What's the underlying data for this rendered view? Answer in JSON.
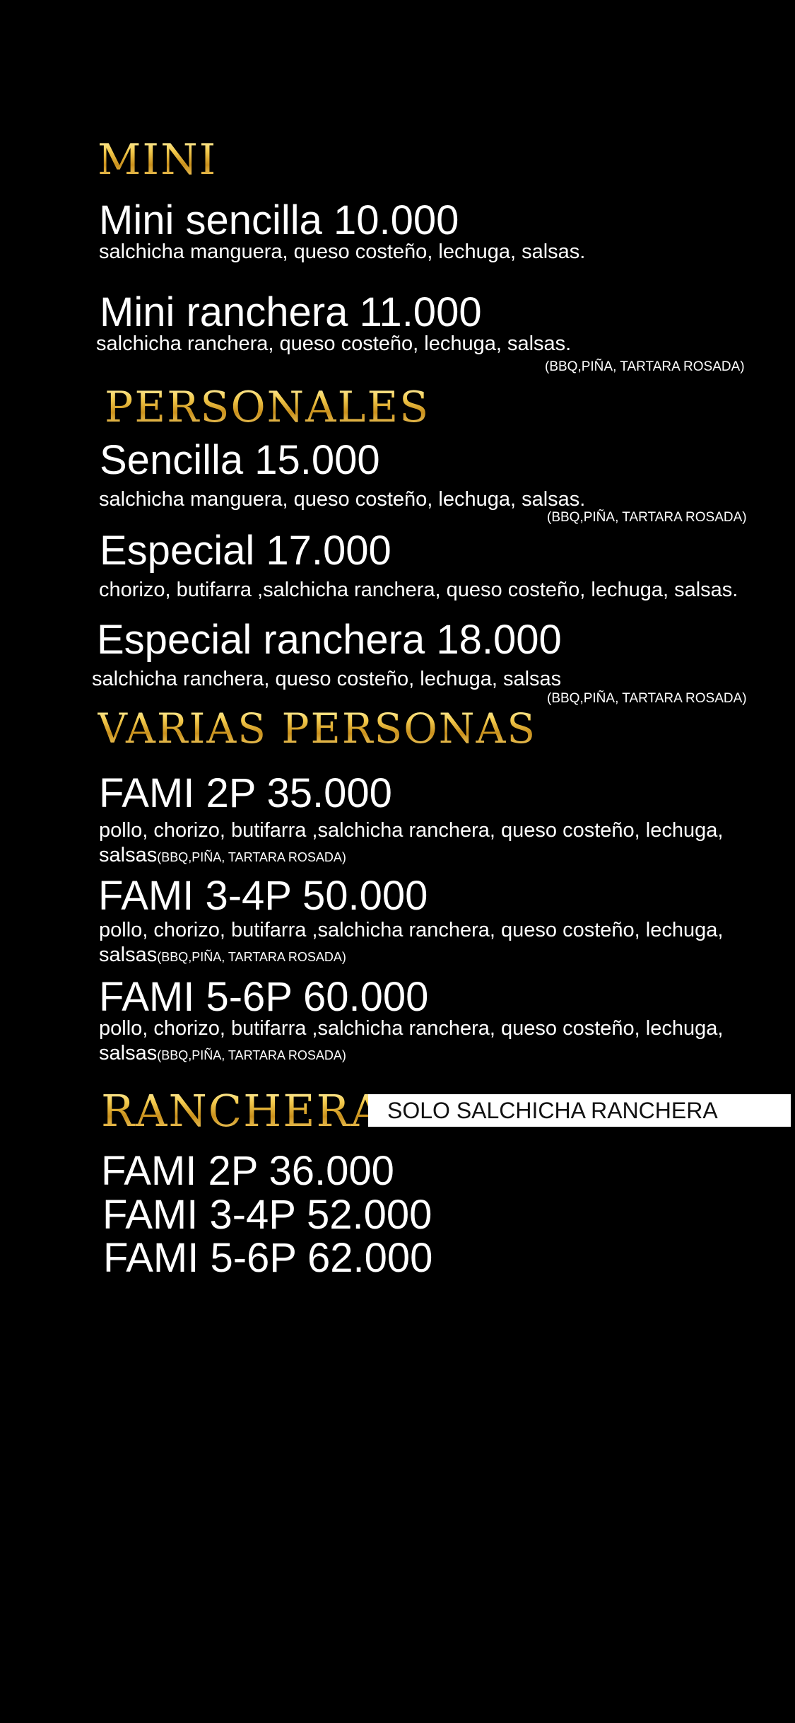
{
  "sections": {
    "mini": {
      "heading": "MINI",
      "items": [
        {
          "name": "Mini sencilla 10.000",
          "desc": "salchicha manguera, queso costeño, lechuga, salsas."
        },
        {
          "name": "Mini ranchera 11.000",
          "desc": "salchicha ranchera, queso costeño, lechuga, salsas.",
          "sauces": "(BBQ,PIÑA, TARTARA ROSADA)"
        }
      ]
    },
    "personales": {
      "heading": "PERSONALES",
      "items": [
        {
          "name": "Sencilla 15.000",
          "desc": "salchicha manguera, queso costeño, lechuga, salsas.",
          "sauces": "(BBQ,PIÑA, TARTARA ROSADA)"
        },
        {
          "name": "Especial 17.000",
          "desc": "chorizo, butifarra ,salchicha ranchera, queso costeño, lechuga, salsas."
        },
        {
          "name": "Especial ranchera 18.000",
          "desc": "salchicha ranchera, queso costeño, lechuga, salsas",
          "sauces": "(BBQ,PIÑA, TARTARA ROSADA)"
        }
      ]
    },
    "varias": {
      "heading": "VARIAS PERSONAS",
      "items": [
        {
          "name": "FAMI 2P  35.000",
          "desc": "pollo, chorizo, butifarra ,salchicha ranchera, queso costeño, lechuga, salsas",
          "sauces": "(BBQ,PIÑA, TARTARA ROSADA)"
        },
        {
          "name": "FAMI 3-4P 50.000",
          "desc": "pollo, chorizo, butifarra ,salchicha ranchera, queso costeño, lechuga, salsas",
          "sauces": "(BBQ,PIÑA, TARTARA ROSADA)"
        },
        {
          "name": "FAMI 5-6P 60.000",
          "desc": "pollo, chorizo, butifarra ,salchicha ranchera, queso costeño, lechuga, salsas",
          "sauces": "(BBQ,PIÑA, TARTARA ROSADA)"
        }
      ]
    },
    "ranchera": {
      "heading": "RANCHERA",
      "note": "SOLO SALCHICHA RANCHERA",
      "items": [
        {
          "name": "FAMI 2P  36.000"
        },
        {
          "name": "FAMI 3-4P 52.000"
        },
        {
          "name": "FAMI 5-6P 62.000"
        }
      ]
    }
  },
  "colors": {
    "background": "#000000",
    "heading_gold": "#e8b63a",
    "text": "#ffffff",
    "note_box": "#ffffff"
  }
}
